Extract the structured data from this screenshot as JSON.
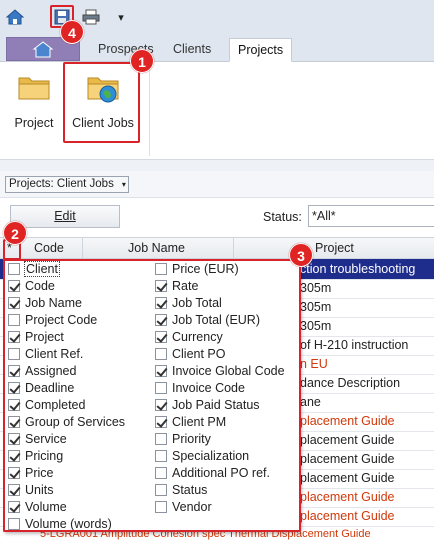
{
  "qat": {
    "dropdown_glyph": "▾"
  },
  "tabs": {
    "prospects": "Prospects",
    "clients": "Clients",
    "projects": "Projects"
  },
  "ribbon": {
    "project_label": "Project",
    "client_jobs_label": "Client Jobs"
  },
  "toolbar": {
    "dropdown_value": "Projects: Client Jobs",
    "dropdown_caret": "▾"
  },
  "editbar": {
    "edit_label": "Edit",
    "status_label": "Status:",
    "status_value": "*All*"
  },
  "grid": {
    "header_star": "*",
    "columns": [
      "Code",
      "Job Name",
      "Project"
    ],
    "rows": [
      {
        "text": "ction troubleshooting",
        "style": "sel"
      },
      {
        "text": "305m",
        "style": ""
      },
      {
        "text": "305m",
        "style": ""
      },
      {
        "text": "305m",
        "style": ""
      },
      {
        "text": "of H-210 instruction",
        "style": ""
      },
      {
        "text": "n EU",
        "style": "red"
      },
      {
        "text": "dance Description",
        "style": ""
      },
      {
        "text": "ane",
        "style": ""
      },
      {
        "text": "placement Guide",
        "style": "red"
      },
      {
        "text": "placement Guide",
        "style": ""
      },
      {
        "text": "placement Guide",
        "style": ""
      },
      {
        "text": "placement Guide",
        "style": ""
      },
      {
        "text": "placement Guide",
        "style": "red"
      },
      {
        "text": "placement Guide",
        "style": "red"
      }
    ],
    "bottom_fragment": "5-LGRA001 Amplitude Cohesion spec Thermal Displacement Guide"
  },
  "column_chooser": {
    "left": [
      {
        "label": "Client",
        "checked": false
      },
      {
        "label": "Code",
        "checked": true
      },
      {
        "label": "Job Name",
        "checked": true
      },
      {
        "label": "Project Code",
        "checked": false
      },
      {
        "label": "Project",
        "checked": true
      },
      {
        "label": "Client Ref.",
        "checked": false
      },
      {
        "label": "Assigned",
        "checked": true
      },
      {
        "label": "Deadline",
        "checked": true
      },
      {
        "label": "Completed",
        "checked": true
      },
      {
        "label": "Group of Services",
        "checked": true
      },
      {
        "label": "Service",
        "checked": true
      },
      {
        "label": "Pricing",
        "checked": true
      },
      {
        "label": "Price",
        "checked": true
      },
      {
        "label": "Units",
        "checked": true
      },
      {
        "label": "Volume",
        "checked": true
      },
      {
        "label": "Volume (words)",
        "checked": false
      }
    ],
    "right": [
      {
        "label": "Price (EUR)",
        "checked": false
      },
      {
        "label": "Rate",
        "checked": true
      },
      {
        "label": "Job Total",
        "checked": true
      },
      {
        "label": "Job Total (EUR)",
        "checked": true
      },
      {
        "label": "Currency",
        "checked": true
      },
      {
        "label": "Client PO",
        "checked": false
      },
      {
        "label": "Invoice Global Code",
        "checked": true
      },
      {
        "label": "Invoice Code",
        "checked": false
      },
      {
        "label": "Job Paid Status",
        "checked": true
      },
      {
        "label": "Client PM",
        "checked": true
      },
      {
        "label": "Priority",
        "checked": false
      },
      {
        "label": "Specialization",
        "checked": false
      },
      {
        "label": "Additional PO ref.",
        "checked": false
      },
      {
        "label": "Status",
        "checked": false
      },
      {
        "label": "Vendor",
        "checked": false
      }
    ]
  },
  "badges": [
    "1",
    "2",
    "3",
    "4"
  ],
  "colors": {
    "highlight": "#d8232a",
    "selected_row": "#1e2c8c",
    "red_text": "#d0390b"
  }
}
